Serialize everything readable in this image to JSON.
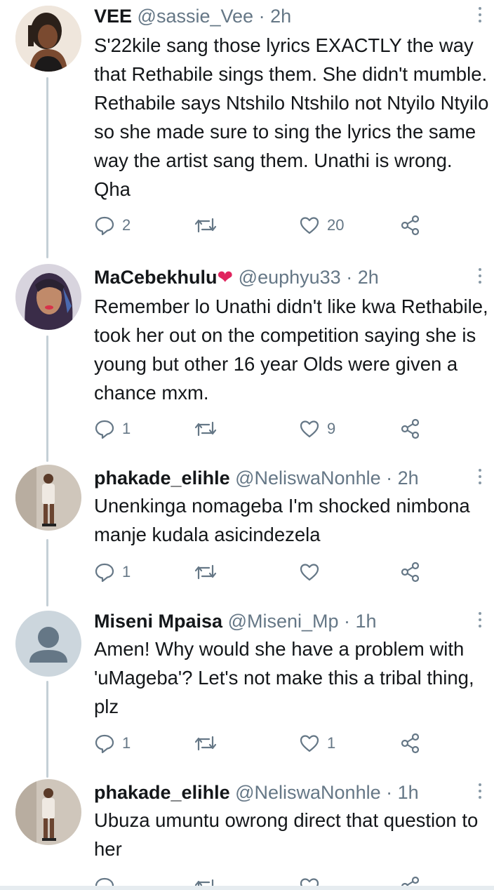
{
  "tweets": [
    {
      "name": "VEE",
      "handle": "@sassie_Vee",
      "time": "2h",
      "text": "S'22kile sang those lyrics EXACTLY the way that Rethabile sings them. She didn't mumble. Rethabile says Ntshilo Ntshilo not Ntyilo Ntyilo so she made sure to sing the lyrics the same way the artist sang them. Unathi is wrong. Qha",
      "replies": "2",
      "retweets": "",
      "likes": "20"
    },
    {
      "name": "MaCebekhulu",
      "name_emoji": "❤",
      "handle": "@euphyu33",
      "time": "2h",
      "text": "Remember lo Unathi didn't like kwa Rethabile, took her out on the competition saying she is young but other 16 year Olds were given a chance mxm.",
      "replies": "1",
      "retweets": "",
      "likes": "9"
    },
    {
      "name": "phakade_elihle",
      "handle": "@NeliswaNonhle",
      "time": "2h",
      "text": "Unenkinga nomageba I'm shocked nimbona manje kudala asicindezela",
      "replies": "1",
      "retweets": "",
      "likes": ""
    },
    {
      "name": "Miseni Mpaisa",
      "handle": "@Miseni_Mp",
      "time": "1h",
      "text": "Amen! Why would she have a problem with 'uMageba'? Let's not make this a tribal thing, plz",
      "replies": "1",
      "retweets": "",
      "likes": "1"
    },
    {
      "name": "phakade_elihle",
      "handle": "@NeliswaNonhle",
      "time": "1h",
      "text": "Ubuza umuntu owrong direct that question to her",
      "replies": "",
      "retweets": "",
      "likes": ""
    }
  ],
  "separator": " · ",
  "icons": {
    "reply": "reply-icon",
    "retweet": "retweet-icon",
    "like": "heart-icon",
    "share": "share-icon",
    "more": "more-icon"
  },
  "colors": {
    "text": "#14171a",
    "meta": "#657786",
    "thread_line": "#c4cfd6",
    "heart_emoji": "#e0245e"
  }
}
